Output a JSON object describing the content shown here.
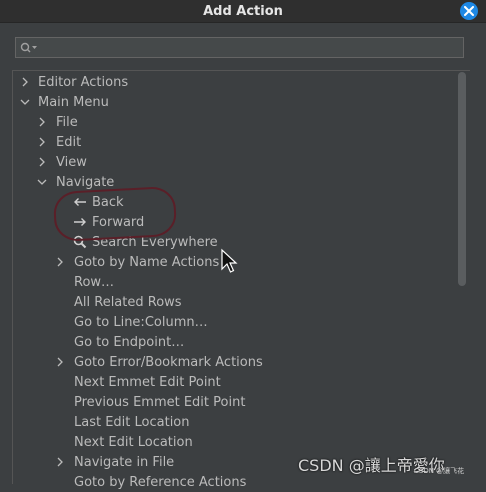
{
  "window": {
    "title": "Add Action"
  },
  "search": {
    "value": "",
    "placeholder": ""
  },
  "tree": {
    "editor_actions": "Editor Actions",
    "main_menu": "Main Menu",
    "file": "File",
    "edit": "Edit",
    "view": "View",
    "navigate": "Navigate",
    "back": "Back",
    "forward": "Forward",
    "search_everywhere": "Search Everywhere",
    "goto_by_name": "Goto by Name Actions",
    "row": "Row…",
    "all_related_rows": "All Related Rows",
    "go_to_line": "Go to Line:Column…",
    "go_to_endpoint": "Go to Endpoint…",
    "goto_error_bookmark": "Goto Error/Bookmark Actions",
    "next_emmet": "Next Emmet Edit Point",
    "prev_emmet": "Previous Emmet Edit Point",
    "last_edit": "Last Edit Location",
    "next_edit": "Next Edit Location",
    "navigate_in_file": "Navigate in File",
    "partial_row": "Goto by Reference Actions"
  },
  "watermark": {
    "main": "CSDN @讓上帝愛你",
    "small": "CSDN @讓飞花"
  },
  "colors": {
    "accent": "#1e88e5",
    "annotation": "#5a1f28"
  },
  "icons": [
    "close-icon",
    "search-icon",
    "left-arrow-icon",
    "right-arrow-icon",
    "magnifier-icon",
    "mouse-cursor-icon"
  ]
}
